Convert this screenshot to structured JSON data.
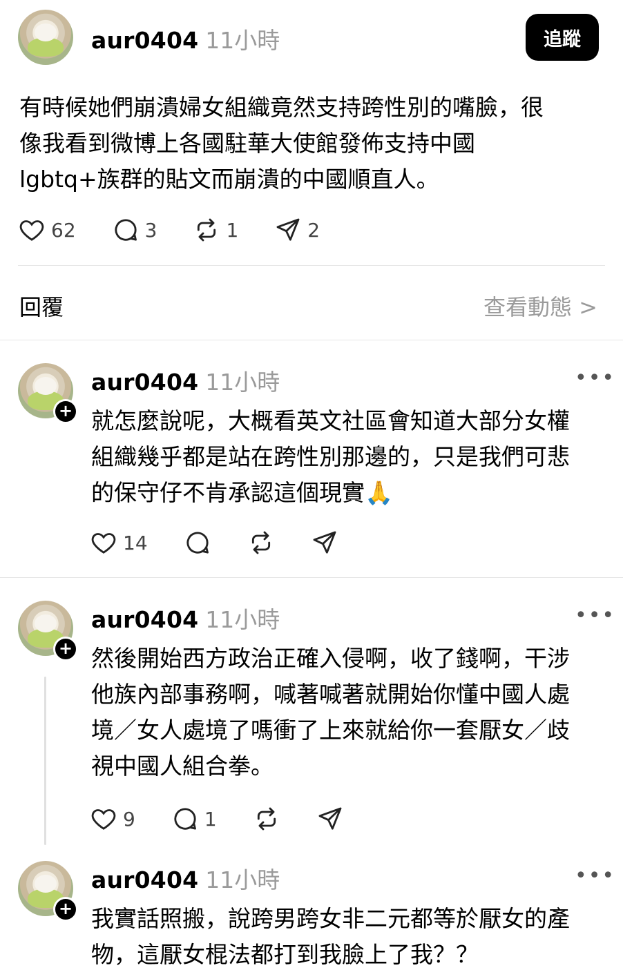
{
  "main_post": {
    "username": "aur0404",
    "time": "11小時",
    "follow_label": "追蹤",
    "text": "有時候她們崩潰婦女組織竟然支持跨性別的嘴臉，很\n像我看到微博上各國駐華大使館發佈支持中國\nlgbtq+族群的貼文而崩潰的中國順直人。",
    "likes": "62",
    "comments": "3",
    "reposts": "1",
    "shares": "2"
  },
  "replies_bar": {
    "label": "回覆",
    "view_activity": "查看動態 >"
  },
  "replies": [
    {
      "username": "aur0404",
      "time": "11小時",
      "text": "就怎麼說呢，大概看英文社區會知道大部分女權\n組織幾乎都是站在跨性別那邊的，只是我們可悲\n的保守仔不肯承認這個現實🙏",
      "likes": "14"
    },
    {
      "username": "aur0404",
      "time": "11小時",
      "text": "然後開始西方政治正確入侵啊，收了錢啊，干涉\n他族內部事務啊，喊著喊著就開始你懂中國人處\n境／女人處境了嗎衝了上來就給你一套厭女／歧\n視中國人組合拳。",
      "likes": "9",
      "comments": "1"
    },
    {
      "username": "aur0404",
      "time": "11小時",
      "text": "我實話照搬，說跨男跨女非二元都等於厭女的產\n物，這厭女棍法都打到我臉上了我？？"
    }
  ],
  "more_icon": "more-dots-icon",
  "icons": [
    "heart-icon",
    "comment-icon",
    "repost-icon",
    "share-icon"
  ]
}
